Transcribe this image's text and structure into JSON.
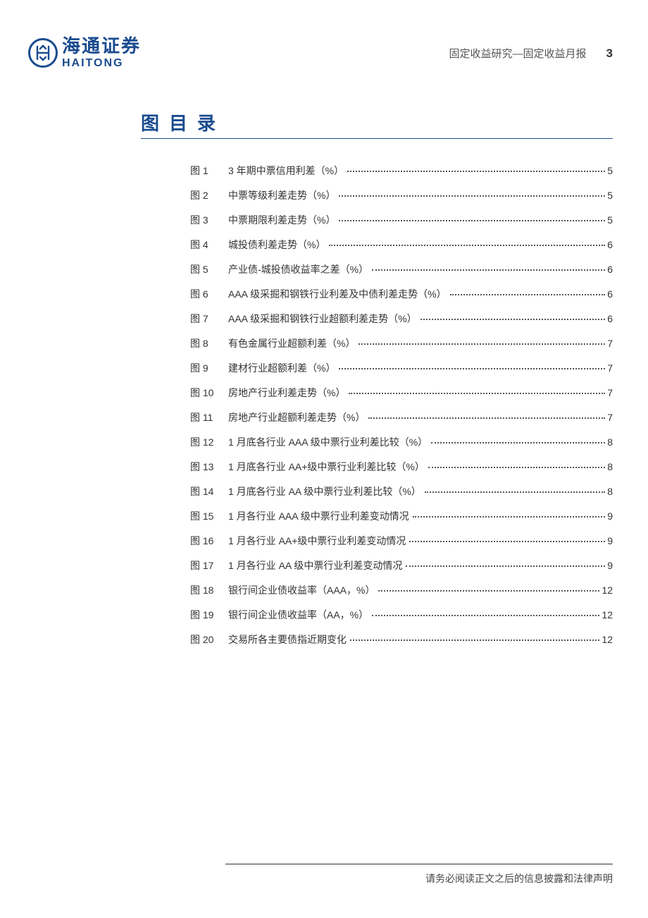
{
  "header": {
    "logo_cn": "海通证券",
    "logo_en": "HAITONG",
    "doc_category": "固定收益研究—固定收益月报",
    "page_number": "3"
  },
  "title": "图目录",
  "toc": [
    {
      "label": "图 1",
      "title": "3 年期中票信用利差（%）",
      "page": "5"
    },
    {
      "label": "图 2",
      "title": "中票等级利差走势（%）",
      "page": "5"
    },
    {
      "label": "图 3",
      "title": "中票期限利差走势（%）",
      "page": "5"
    },
    {
      "label": "图 4",
      "title": "城投债利差走势（%）",
      "page": "6"
    },
    {
      "label": "图 5",
      "title": "产业债-城投债收益率之差（%）",
      "page": "6"
    },
    {
      "label": "图 6",
      "title": "AAA 级采掘和钢铁行业利差及中债利差走势（%）",
      "page": "6"
    },
    {
      "label": "图 7",
      "title": "AAA 级采掘和钢铁行业超额利差走势（%）",
      "page": "6"
    },
    {
      "label": "图 8",
      "title": "有色金属行业超额利差（%）",
      "page": "7"
    },
    {
      "label": "图 9",
      "title": "建材行业超额利差（%）",
      "page": "7"
    },
    {
      "label": "图 10",
      "title": "房地产行业利差走势（%）",
      "page": "7"
    },
    {
      "label": "图 11",
      "title": "房地产行业超额利差走势（%）",
      "page": "7"
    },
    {
      "label": "图 12",
      "title": "1 月底各行业 AAA 级中票行业利差比较（%）",
      "page": "8"
    },
    {
      "label": "图 13",
      "title": "1 月底各行业 AA+级中票行业利差比较（%）",
      "page": "8"
    },
    {
      "label": "图 14",
      "title": "1 月底各行业 AA 级中票行业利差比较（%）",
      "page": "8"
    },
    {
      "label": "图 15",
      "title": "1 月各行业 AAA 级中票行业利差变动情况",
      "page": "9"
    },
    {
      "label": "图 16",
      "title": "1 月各行业 AA+级中票行业利差变动情况",
      "page": "9"
    },
    {
      "label": "图 17",
      "title": "1 月各行业 AA 级中票行业利差变动情况",
      "page": "9"
    },
    {
      "label": "图 18",
      "title": "银行间企业债收益率（AAA，%）",
      "page": "12"
    },
    {
      "label": "图 19",
      "title": "银行间企业债收益率（AA，%）",
      "page": "12"
    },
    {
      "label": "图 20",
      "title": "交易所各主要债指近期变化",
      "page": "12"
    }
  ],
  "footer": "请务必阅读正文之后的信息披露和法律声明"
}
